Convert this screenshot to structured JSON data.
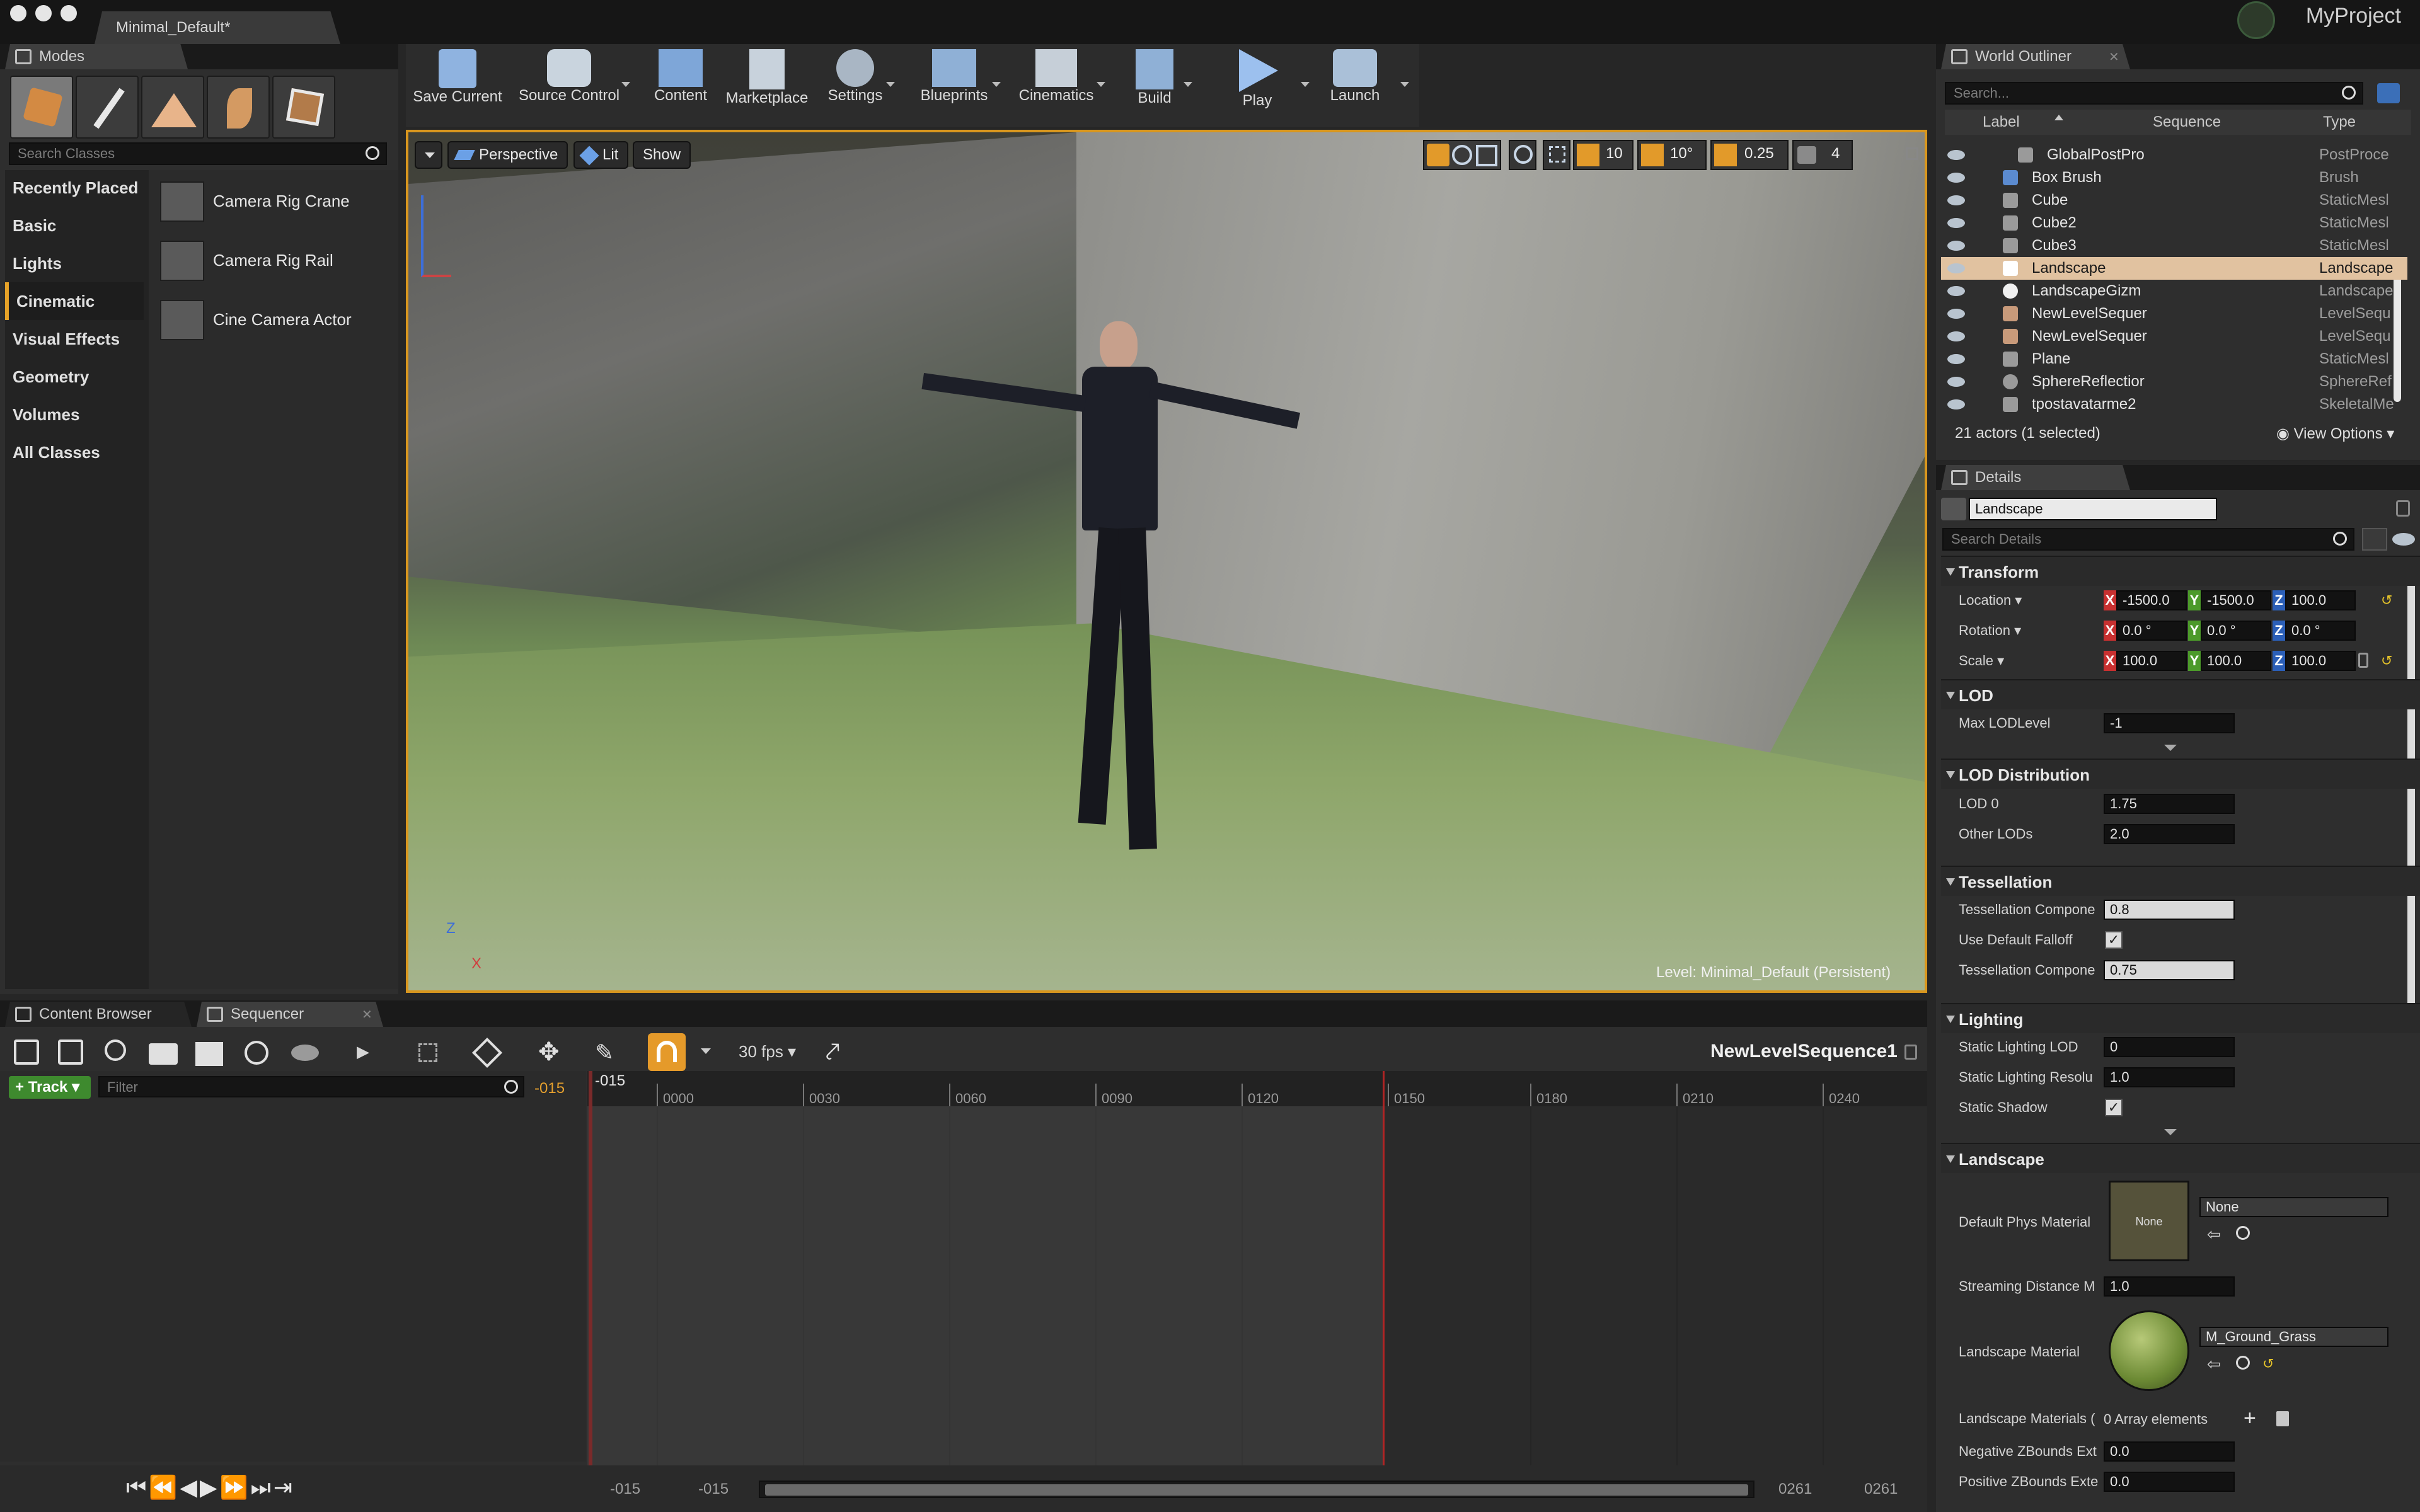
{
  "window": {
    "doc_tab": "Minimal_Default*",
    "project": "MyProject"
  },
  "modes": {
    "tab": "Modes",
    "search_placeholder": "Search Classes",
    "categories": [
      "Recently Placed",
      "Basic",
      "Lights",
      "Cinematic",
      "Visual Effects",
      "Geometry",
      "Volumes",
      "All Classes"
    ],
    "selected_category": "Cinematic",
    "items": [
      "Camera Rig Crane",
      "Camera Rig Rail",
      "Cine Camera Actor"
    ]
  },
  "toolbar": {
    "buttons": [
      "Save Current",
      "Source Control",
      "Content",
      "Marketplace",
      "Settings",
      "Blueprints",
      "Cinematics",
      "Build",
      "Play",
      "Launch"
    ]
  },
  "viewport": {
    "perspective": "Perspective",
    "lit": "Lit",
    "show": "Show",
    "grid_snap": "10",
    "rot_snap": "10°",
    "scale_snap": "0.25",
    "cam_speed": "4",
    "level_label": "Level:",
    "level_name": "Minimal_Default (Persistent)",
    "axis_z": "Z",
    "axis_x": "X"
  },
  "outliner": {
    "tab": "World Outliner",
    "search_placeholder": "Search...",
    "columns": [
      "Label",
      "Sequence",
      "Type"
    ],
    "rows": [
      {
        "label": "GlobalPostPro",
        "type": "PostProce"
      },
      {
        "label": "Box Brush",
        "type": "Brush"
      },
      {
        "label": "Cube",
        "type": "StaticMesl"
      },
      {
        "label": "Cube2",
        "type": "StaticMesl"
      },
      {
        "label": "Cube3",
        "type": "StaticMesl"
      },
      {
        "label": "Landscape",
        "type": "Landscape"
      },
      {
        "label": "LandscapeGizm",
        "type": "Landscape"
      },
      {
        "label": "NewLevelSequer",
        "type": "LevelSequ"
      },
      {
        "label": "NewLevelSequer",
        "type": "LevelSequ"
      },
      {
        "label": "Plane",
        "type": "StaticMesl"
      },
      {
        "label": "SphereReflectior",
        "type": "SphereRef"
      },
      {
        "label": "tpostavatarme2",
        "type": "SkeletalMe"
      }
    ],
    "selected_index": 5,
    "status": "21 actors (1 selected)",
    "view_options": "View Options"
  },
  "details": {
    "tab": "Details",
    "name_field": "Landscape",
    "search_placeholder": "Search Details",
    "transform": {
      "title": "Transform",
      "location_label": "Location",
      "rotation_label": "Rotation",
      "scale_label": "Scale",
      "location": [
        "-1500.0",
        "-1500.0",
        "100.0"
      ],
      "rotation": [
        "0.0 °",
        "0.0 °",
        "0.0 °"
      ],
      "scale": [
        "100.0",
        "100.0",
        "100.0"
      ],
      "axes": [
        "X",
        "Y",
        "Z"
      ]
    },
    "lod": {
      "title": "LOD",
      "max_lod_label": "Max LODLevel",
      "max_lod": "-1"
    },
    "lod_dist": {
      "title": "LOD Distribution",
      "lod0_label": "LOD 0",
      "lod0": "1.75",
      "other_label": "Other LODs",
      "other": "2.0"
    },
    "tess": {
      "title": "Tessellation",
      "comp1_label": "Tessellation Compone",
      "comp1": "0.8",
      "falloff_label": "Use Default Falloff",
      "comp2_label": "Tessellation Compone",
      "comp2": "0.75"
    },
    "lighting": {
      "title": "Lighting",
      "lod_label": "Static Lighting LOD",
      "lod": "0",
      "res_label": "Static Lighting Resolu",
      "res": "1.0",
      "shadow_label": "Static Shadow"
    },
    "landscape": {
      "title": "Landscape",
      "phys_label": "Default Phys Material",
      "phys_thumb": "None",
      "phys_value": "None",
      "stream_label": "Streaming Distance M",
      "stream": "1.0",
      "mat_label": "Landscape Material",
      "mat_value": "M_Ground_Grass",
      "mats_label": "Landscape Materials (",
      "mats_value": "0 Array elements",
      "neg_label": "Negative ZBounds Ext",
      "neg": "0.0",
      "pos_label": "Positive ZBounds Exte",
      "pos": "0.0"
    }
  },
  "bottom_tabs": {
    "content_browser": "Content Browser",
    "sequencer": "Sequencer"
  },
  "sequencer": {
    "fps": "30 fps",
    "sequence_name": "NewLevelSequence1",
    "track_button": "Track",
    "filter_placeholder": "Filter",
    "current_frame": "-015",
    "playhead_label": "-015",
    "ruler": [
      "0000",
      "0030",
      "0060",
      "0090",
      "0120",
      "0150",
      "0180",
      "0210",
      "0240"
    ],
    "range_start": "-015",
    "range_view_start": "-015",
    "range_view_end": "0261",
    "range_end": "0261"
  }
}
